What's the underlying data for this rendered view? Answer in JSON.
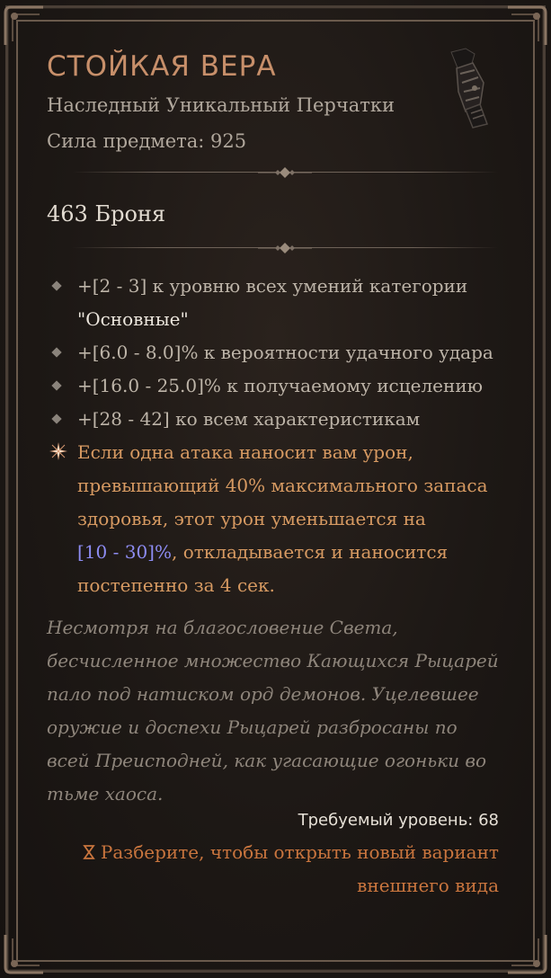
{
  "item": {
    "name": "СТОЙКАЯ ВЕРА",
    "type": "Наследный Уникальный Перчатки",
    "power": "Сила предмета: 925",
    "armor": "463 Броня",
    "icon": "gauntlet-icon"
  },
  "affixes": [
    {
      "prefix": "+[2 - 3] к уровню всех умений категории",
      "highlight": "\"Основные\""
    },
    {
      "text": "+[6.0 - 8.0]% к вероятности удачного удара"
    },
    {
      "text": "+[16.0 - 25.0]% к получаемому исцелению"
    },
    {
      "text": "+[28 - 42] ко всем характеристикам"
    }
  ],
  "unique_power": {
    "text_before": "Если одна атака наносит вам урон, превышающий 40% максимального запаса здоровья, этот урон уменьшается на",
    "range": "[10 - 30]%",
    "text_after": ", откладывается и наносится постепенно за 4 сек."
  },
  "flavor_text": "Несмотря на благословение Света, бесчисленное множество Кающихся Рыцарей пало под натиском орд демонов. Уцелевшее оружие и доспехи Рыцарей разбросаны по всей Преисподней, как угасающие огоньки во тьме хаоса.",
  "required_level": "Требуемый уровень: 68",
  "salvage_hint": "Разберите, чтобы открыть новый вариант внешнего вида",
  "colors": {
    "title": "#c78f6a",
    "unique_power": "#d79a62",
    "range": "#8d8cf2",
    "salvage": "#c9753e"
  }
}
